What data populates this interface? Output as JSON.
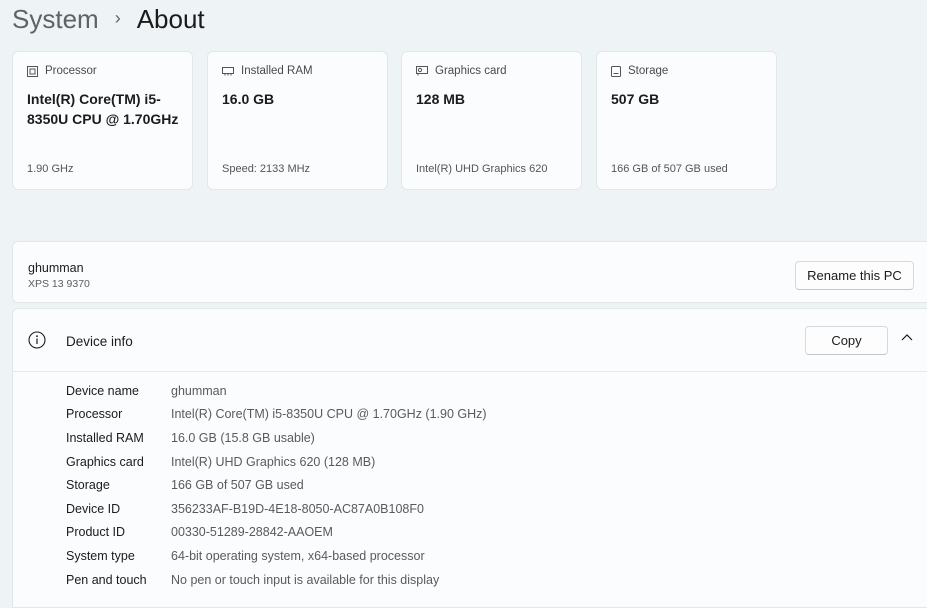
{
  "breadcrumb": {
    "parent": "System",
    "separator": "›",
    "current": "About"
  },
  "specs": [
    {
      "icon": "processor-icon",
      "label": "Processor",
      "value": "Intel(R) Core(TM) i5-8350U CPU @ 1.70GHz",
      "sub": "1.90 GHz"
    },
    {
      "icon": "ram-icon",
      "label": "Installed RAM",
      "value": "16.0 GB",
      "sub": "Speed: 2133 MHz"
    },
    {
      "icon": "graphics-card-icon",
      "label": "Graphics card",
      "value": "128 MB",
      "sub": "Intel(R) UHD Graphics 620"
    },
    {
      "icon": "storage-icon",
      "label": "Storage",
      "value": "507 GB",
      "sub": "166 GB of 507 GB used"
    }
  ],
  "pc": {
    "name": "ghumman",
    "model": "XPS 13 9370",
    "rename_label": "Rename this PC"
  },
  "device_info": {
    "title": "Device info",
    "copy_label": "Copy",
    "rows": [
      {
        "label": "Device name",
        "value": "ghumman"
      },
      {
        "label": "Processor",
        "value": "Intel(R) Core(TM) i5-8350U CPU @ 1.70GHz (1.90 GHz)"
      },
      {
        "label": "Installed RAM",
        "value": "16.0 GB (15.8 GB usable)"
      },
      {
        "label": "Graphics card",
        "value": "Intel(R) UHD Graphics 620 (128 MB)"
      },
      {
        "label": "Storage",
        "value": "166 GB of 507 GB used"
      },
      {
        "label": "Device ID",
        "value": "356233AF-B19D-4E18-8050-AC87A0B108F0"
      },
      {
        "label": "Product ID",
        "value": "00330-51289-28842-AAOEM"
      },
      {
        "label": "System type",
        "value": "64-bit operating system, x64-based processor"
      },
      {
        "label": "Pen and touch",
        "value": "No pen or touch input is available for this display"
      }
    ]
  }
}
